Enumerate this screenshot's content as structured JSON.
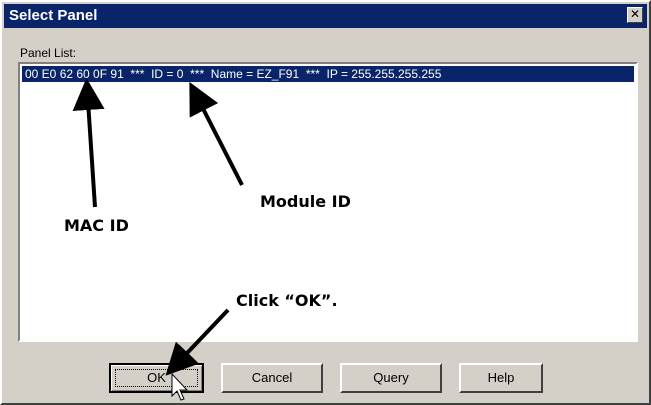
{
  "window": {
    "title": "Select Panel",
    "close_glyph": "✕"
  },
  "panel_list": {
    "label": "Panel List:",
    "items": [
      "00 E0 62 60 0F 91  ***  ID = 0  ***  Name = EZ_F91  ***  IP = 255.255.255.255"
    ]
  },
  "buttons": {
    "ok": "OK",
    "cancel": "Cancel",
    "query": "Query",
    "help": "Help"
  },
  "annotations": {
    "mac_id": "MAC ID",
    "module_id": "Module ID",
    "click_ok": "Click “OK”."
  },
  "colors": {
    "titlebar": "#0a246a",
    "selection": "#0a246a",
    "dialog_bg": "#d4d0c8"
  }
}
